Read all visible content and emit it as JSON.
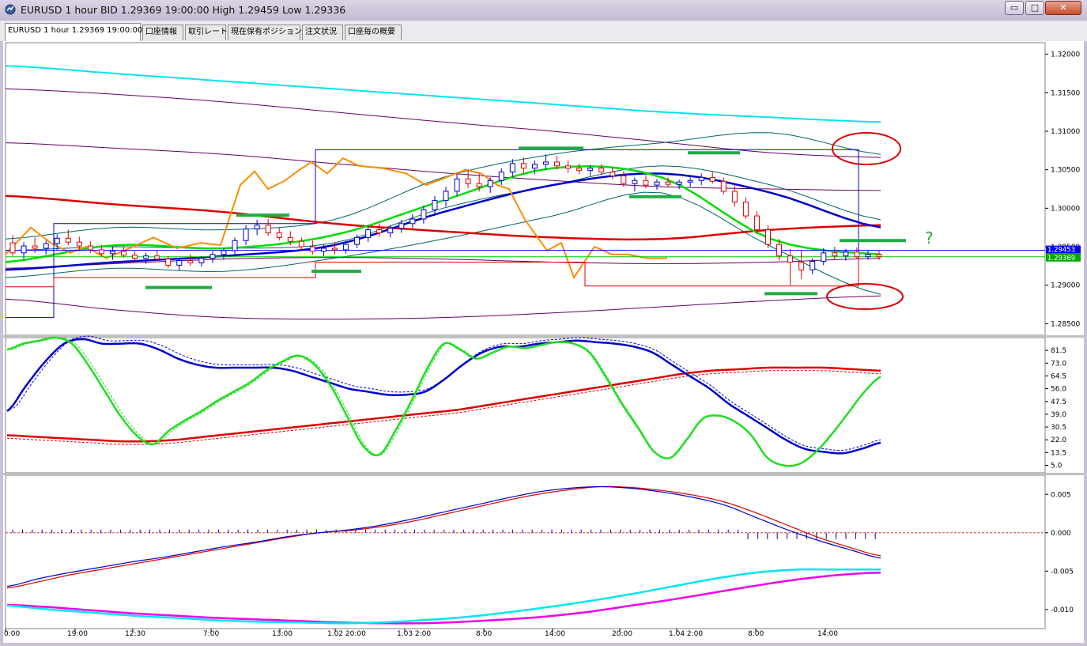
{
  "window": {
    "title": "EURUSD 1 hour BID 1.29369 19:00:00 High 1.29459 Low 1.29336",
    "buttons": {
      "minimize": "▭",
      "maximize": "□",
      "close": "✕"
    }
  },
  "tabs": [
    {
      "label": "EURUSD 1 hour 1.29369 19:00:00",
      "active": true
    },
    {
      "label": "口座情報",
      "active": false
    },
    {
      "label": "取引レート",
      "active": false
    },
    {
      "label": "現在保有ポジション",
      "active": false
    },
    {
      "label": "注文状況",
      "active": false
    },
    {
      "label": "口座毎の概要",
      "active": false
    }
  ],
  "chart_data": [
    {
      "type": "candlestick",
      "symbol": "EURUSD",
      "timeframe": "1 hour",
      "y_ticks": [
        "1.32000",
        "1.31500",
        "1.31000",
        "1.30500",
        "1.30000",
        "1.29500",
        "1.29000",
        "1.28500"
      ],
      "ylim": [
        1.2835,
        1.3215
      ],
      "price_labels": [
        "1.29453",
        "1.29369"
      ],
      "price_label_colors": [
        "#0000ff",
        "#00aa00"
      ],
      "annotation": "?",
      "annotation_color": "#33aa33",
      "colors": {
        "bull": "#0000cc",
        "bear": "#dd0000",
        "sma_fast": "#00dd00",
        "sma_mid": "#0000cc",
        "sma_slow": "#dd0000",
        "sma_long": "#00e5ee",
        "envelope": "#660066",
        "bollinger": "#006666",
        "zigzag": "#ff8c00",
        "highlight_marks": "#22aa44",
        "circles": "#dd0000"
      },
      "candles": [
        {
          "o": 1.2955,
          "h": 1.2965,
          "l": 1.2938,
          "c": 1.2942
        },
        {
          "o": 1.2942,
          "h": 1.2956,
          "l": 1.2934,
          "c": 1.2951
        },
        {
          "o": 1.2951,
          "h": 1.2962,
          "l": 1.2942,
          "c": 1.2948
        },
        {
          "o": 1.2948,
          "h": 1.2958,
          "l": 1.294,
          "c": 1.2954
        },
        {
          "o": 1.2954,
          "h": 1.2966,
          "l": 1.2946,
          "c": 1.2961
        },
        {
          "o": 1.2961,
          "h": 1.2972,
          "l": 1.2952,
          "c": 1.2956
        },
        {
          "o": 1.2956,
          "h": 1.2963,
          "l": 1.2946,
          "c": 1.2951
        },
        {
          "o": 1.2951,
          "h": 1.2957,
          "l": 1.2942,
          "c": 1.2946
        },
        {
          "o": 1.2946,
          "h": 1.2952,
          "l": 1.2938,
          "c": 1.2941
        },
        {
          "o": 1.2941,
          "h": 1.295,
          "l": 1.2933,
          "c": 1.2944
        },
        {
          "o": 1.2944,
          "h": 1.295,
          "l": 1.2936,
          "c": 1.2939
        },
        {
          "o": 1.2939,
          "h": 1.2944,
          "l": 1.2931,
          "c": 1.2935
        },
        {
          "o": 1.2935,
          "h": 1.2942,
          "l": 1.2928,
          "c": 1.2938
        },
        {
          "o": 1.2938,
          "h": 1.2945,
          "l": 1.2932,
          "c": 1.2934
        },
        {
          "o": 1.2934,
          "h": 1.2938,
          "l": 1.2922,
          "c": 1.2926
        },
        {
          "o": 1.2926,
          "h": 1.2936,
          "l": 1.2919,
          "c": 1.2932
        },
        {
          "o": 1.2932,
          "h": 1.294,
          "l": 1.2925,
          "c": 1.2929
        },
        {
          "o": 1.2929,
          "h": 1.2938,
          "l": 1.2924,
          "c": 1.2935
        },
        {
          "o": 1.2935,
          "h": 1.2944,
          "l": 1.2929,
          "c": 1.294
        },
        {
          "o": 1.294,
          "h": 1.2948,
          "l": 1.2934,
          "c": 1.2945
        },
        {
          "o": 1.2945,
          "h": 1.2962,
          "l": 1.294,
          "c": 1.2958
        },
        {
          "o": 1.2958,
          "h": 1.2978,
          "l": 1.2952,
          "c": 1.2973
        },
        {
          "o": 1.2973,
          "h": 1.2985,
          "l": 1.2965,
          "c": 1.2978
        },
        {
          "o": 1.2978,
          "h": 1.2986,
          "l": 1.2964,
          "c": 1.2968
        },
        {
          "o": 1.2968,
          "h": 1.2975,
          "l": 1.2958,
          "c": 1.2962
        },
        {
          "o": 1.2962,
          "h": 1.297,
          "l": 1.2952,
          "c": 1.2957
        },
        {
          "o": 1.2957,
          "h": 1.2962,
          "l": 1.2945,
          "c": 1.295
        },
        {
          "o": 1.295,
          "h": 1.2958,
          "l": 1.294,
          "c": 1.2944
        },
        {
          "o": 1.2944,
          "h": 1.2953,
          "l": 1.2938,
          "c": 1.2948
        },
        {
          "o": 1.2948,
          "h": 1.2956,
          "l": 1.294,
          "c": 1.2946
        },
        {
          "o": 1.2946,
          "h": 1.2958,
          "l": 1.2941,
          "c": 1.2953
        },
        {
          "o": 1.2953,
          "h": 1.2966,
          "l": 1.2948,
          "c": 1.2962
        },
        {
          "o": 1.2962,
          "h": 1.2978,
          "l": 1.2956,
          "c": 1.2972
        },
        {
          "o": 1.2972,
          "h": 1.298,
          "l": 1.2963,
          "c": 1.2968
        },
        {
          "o": 1.2968,
          "h": 1.2978,
          "l": 1.2962,
          "c": 1.2974
        },
        {
          "o": 1.2974,
          "h": 1.2985,
          "l": 1.2968,
          "c": 1.298
        },
        {
          "o": 1.298,
          "h": 1.2992,
          "l": 1.2974,
          "c": 1.2986
        },
        {
          "o": 1.2986,
          "h": 1.3003,
          "l": 1.298,
          "c": 1.2998
        },
        {
          "o": 1.2998,
          "h": 1.3016,
          "l": 1.299,
          "c": 1.301
        },
        {
          "o": 1.301,
          "h": 1.3028,
          "l": 1.3002,
          "c": 1.3022
        },
        {
          "o": 1.3022,
          "h": 1.3045,
          "l": 1.3016,
          "c": 1.3038
        },
        {
          "o": 1.3038,
          "h": 1.305,
          "l": 1.3026,
          "c": 1.3032
        },
        {
          "o": 1.3032,
          "h": 1.3045,
          "l": 1.3022,
          "c": 1.3028
        },
        {
          "o": 1.3028,
          "h": 1.304,
          "l": 1.302,
          "c": 1.3036
        },
        {
          "o": 1.3036,
          "h": 1.3052,
          "l": 1.303,
          "c": 1.3047
        },
        {
          "o": 1.3047,
          "h": 1.3064,
          "l": 1.304,
          "c": 1.3058
        },
        {
          "o": 1.3058,
          "h": 1.3066,
          "l": 1.3045,
          "c": 1.3052
        },
        {
          "o": 1.3052,
          "h": 1.3062,
          "l": 1.3044,
          "c": 1.3057
        },
        {
          "o": 1.3057,
          "h": 1.307,
          "l": 1.305,
          "c": 1.306
        },
        {
          "o": 1.306,
          "h": 1.3068,
          "l": 1.305,
          "c": 1.3055
        },
        {
          "o": 1.3055,
          "h": 1.3062,
          "l": 1.3046,
          "c": 1.3052
        },
        {
          "o": 1.3052,
          "h": 1.3058,
          "l": 1.3044,
          "c": 1.3049
        },
        {
          "o": 1.3049,
          "h": 1.3056,
          "l": 1.3042,
          "c": 1.3052
        },
        {
          "o": 1.3052,
          "h": 1.3057,
          "l": 1.3043,
          "c": 1.3047
        },
        {
          "o": 1.3047,
          "h": 1.3053,
          "l": 1.3038,
          "c": 1.3042
        },
        {
          "o": 1.3042,
          "h": 1.3048,
          "l": 1.3028,
          "c": 1.3032
        },
        {
          "o": 1.3032,
          "h": 1.304,
          "l": 1.3022,
          "c": 1.3036
        },
        {
          "o": 1.3036,
          "h": 1.3043,
          "l": 1.3026,
          "c": 1.303
        },
        {
          "o": 1.303,
          "h": 1.3038,
          "l": 1.3024,
          "c": 1.3034
        },
        {
          "o": 1.3034,
          "h": 1.304,
          "l": 1.3027,
          "c": 1.3031
        },
        {
          "o": 1.3031,
          "h": 1.3037,
          "l": 1.3025,
          "c": 1.3034
        },
        {
          "o": 1.3034,
          "h": 1.304,
          "l": 1.3028,
          "c": 1.3036
        },
        {
          "o": 1.3036,
          "h": 1.3045,
          "l": 1.303,
          "c": 1.304
        },
        {
          "o": 1.304,
          "h": 1.3048,
          "l": 1.3032,
          "c": 1.3035
        },
        {
          "o": 1.3035,
          "h": 1.304,
          "l": 1.3018,
          "c": 1.3022
        },
        {
          "o": 1.3022,
          "h": 1.303,
          "l": 1.3002,
          "c": 1.3008
        },
        {
          "o": 1.3008,
          "h": 1.3014,
          "l": 1.2986,
          "c": 1.299
        },
        {
          "o": 1.299,
          "h": 1.2996,
          "l": 1.2966,
          "c": 1.2972
        },
        {
          "o": 1.2972,
          "h": 1.2978,
          "l": 1.2948,
          "c": 1.2953
        },
        {
          "o": 1.2953,
          "h": 1.296,
          "l": 1.2932,
          "c": 1.2938
        },
        {
          "o": 1.2938,
          "h": 1.2947,
          "l": 1.29,
          "c": 1.293
        },
        {
          "o": 1.293,
          "h": 1.2945,
          "l": 1.2908,
          "c": 1.292
        },
        {
          "o": 1.292,
          "h": 1.2935,
          "l": 1.2914,
          "c": 1.2931
        },
        {
          "o": 1.2931,
          "h": 1.2948,
          "l": 1.2926,
          "c": 1.2942
        },
        {
          "o": 1.2942,
          "h": 1.295,
          "l": 1.2933,
          "c": 1.2938
        },
        {
          "o": 1.2938,
          "h": 1.2947,
          "l": 1.2932,
          "c": 1.2943
        },
        {
          "o": 1.2943,
          "h": 1.2949,
          "l": 1.2934,
          "c": 1.2937
        },
        {
          "o": 1.2937,
          "h": 1.2945,
          "l": 1.2933,
          "c": 1.294
        },
        {
          "o": 1.294,
          "h": 1.2946,
          "l": 1.2933,
          "c": 1.2937
        }
      ]
    },
    {
      "type": "line",
      "panel": "stochastic",
      "y_ticks": [
        "81.5",
        "73.0",
        "64.5",
        "56.0",
        "47.5",
        "39.0",
        "30.5",
        "22.0",
        "13.5",
        "5.0"
      ],
      "ylim": [
        0,
        90
      ],
      "colors": {
        "green": "#22dd22",
        "blue": "#0000cc",
        "red": "#dd0000"
      },
      "green": [
        82,
        86,
        88,
        90,
        86,
        72,
        55,
        38,
        25,
        19,
        28,
        35,
        41,
        48,
        54,
        60,
        68,
        74,
        78,
        72,
        58,
        38,
        18,
        12,
        28,
        48,
        70,
        86,
        82,
        76,
        80,
        84,
        83,
        85,
        87,
        86,
        80,
        64,
        46,
        30,
        14,
        10,
        22,
        36,
        38,
        34,
        25,
        10,
        5,
        6,
        14,
        26,
        40,
        54,
        64
      ],
      "blue": [
        41,
        58,
        74,
        86,
        89,
        86,
        86,
        86,
        82,
        76,
        72,
        70,
        70,
        70,
        70,
        68,
        64,
        60,
        56,
        54,
        52,
        52,
        54,
        62,
        72,
        80,
        84,
        84,
        86,
        87,
        88,
        87,
        86,
        84,
        80,
        72,
        64,
        56,
        46,
        38,
        30,
        22,
        16,
        14,
        13,
        16,
        20
      ],
      "red": [
        25,
        24,
        23,
        22,
        21,
        21,
        22,
        24,
        26,
        28,
        30,
        32,
        34,
        36,
        38,
        40,
        42,
        45,
        48,
        51,
        54,
        57,
        60,
        63,
        66,
        68,
        69,
        70,
        70,
        70,
        69,
        68
      ]
    },
    {
      "type": "line",
      "panel": "macd",
      "y_ticks": [
        "0.005",
        "0.000",
        "-0.005",
        "-0.010"
      ],
      "ylim": [
        -0.0125,
        0.0075
      ],
      "colors": {
        "blue": "#0000cc",
        "red": "#dd0000",
        "cyan": "#00e5ee",
        "magenta": "#ee00ee",
        "zero_line": "#cc4444"
      },
      "blue": [
        -0.007,
        -0.006,
        -0.0052,
        -0.0045,
        -0.0038,
        -0.0032,
        -0.0025,
        -0.0018,
        -0.0012,
        -0.0005,
        0.0,
        0.0004,
        0.001,
        0.0018,
        0.0027,
        0.0036,
        0.0045,
        0.0053,
        0.0058,
        0.006,
        0.0058,
        0.0053,
        0.0046,
        0.0036,
        0.002,
        0.0004,
        -0.001,
        -0.0022,
        -0.0033
      ],
      "red": [
        -0.0072,
        -0.0064,
        -0.0055,
        -0.0048,
        -0.0041,
        -0.0034,
        -0.0027,
        -0.002,
        -0.0013,
        -0.0006,
        0.0,
        0.0003,
        0.0008,
        0.0015,
        0.0024,
        0.0033,
        0.0042,
        0.005,
        0.0056,
        0.006,
        0.0059,
        0.0055,
        0.0049,
        0.004,
        0.0026,
        0.001,
        -0.0006,
        -0.0019,
        -0.003
      ],
      "cyan": [
        -0.0095,
        -0.01,
        -0.0104,
        -0.0108,
        -0.0111,
        -0.0114,
        -0.0116,
        -0.0117,
        -0.0118,
        -0.0117,
        -0.0114,
        -0.011,
        -0.0104,
        -0.0097,
        -0.0089,
        -0.008,
        -0.007,
        -0.006,
        -0.0052,
        -0.0048,
        -0.0048,
        -0.0048
      ],
      "magenta": [
        -0.0094,
        -0.0097,
        -0.0101,
        -0.0105,
        -0.0108,
        -0.0111,
        -0.0113,
        -0.0115,
        -0.0117,
        -0.0118,
        -0.0118,
        -0.0116,
        -0.0113,
        -0.0109,
        -0.0103,
        -0.0095,
        -0.0087,
        -0.0078,
        -0.0069,
        -0.0061,
        -0.0055,
        -0.0052
      ]
    }
  ],
  "x_axis": {
    "labels": [
      "0:00",
      "19:00",
      "12:30",
      "7:00",
      "13:00",
      "1.02  20:00",
      "1.03  2:00",
      "8:00",
      "14:00",
      "20:00",
      "1.04  2:00",
      "8:00",
      "14:00"
    ]
  }
}
